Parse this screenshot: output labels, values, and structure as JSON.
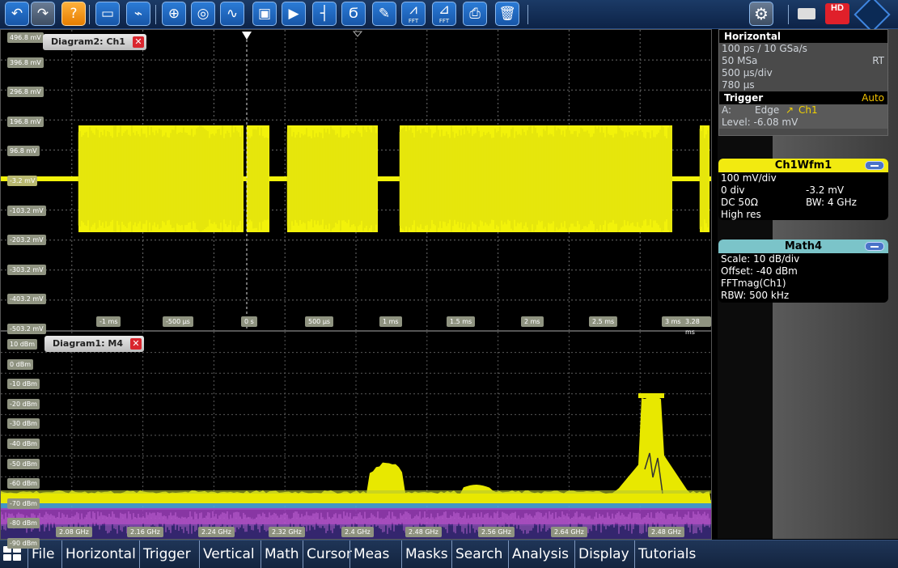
{
  "toolbar": {
    "buttons": [
      {
        "icon": "undo-icon",
        "glyph": "↶",
        "color": "blue"
      },
      {
        "icon": "redo-icon",
        "glyph": "↷",
        "color": "gray"
      },
      {
        "icon": "help-icon",
        "glyph": "?",
        "color": "orange"
      },
      {
        "icon": "open-folder-icon",
        "glyph": "▭",
        "color": "blue"
      },
      {
        "icon": "autoset-icon",
        "glyph": "⌁",
        "color": "blue"
      },
      {
        "icon": "zoom-icon",
        "glyph": "⊕",
        "color": "blue"
      },
      {
        "icon": "binoculars-icon",
        "glyph": "◎",
        "color": "blue"
      },
      {
        "icon": "measurement-icon",
        "glyph": "∿",
        "color": "blue"
      },
      {
        "icon": "mask-icon",
        "glyph": "▣",
        "color": "blue"
      },
      {
        "icon": "cursor-icon",
        "glyph": "▶",
        "color": "blue"
      },
      {
        "icon": "marker-icon",
        "glyph": "┤",
        "color": "blue"
      },
      {
        "icon": "histogram-icon",
        "glyph": "Ϭ",
        "color": "blue"
      },
      {
        "icon": "pencil-icon",
        "glyph": "✎",
        "color": "blue"
      },
      {
        "icon": "fft-icon",
        "glyph": "⩘",
        "label": "FFT",
        "color": "blue"
      },
      {
        "icon": "fft-gate-icon",
        "glyph": "⊿",
        "label": "FFT",
        "color": "blue"
      },
      {
        "icon": "print-icon",
        "glyph": "⎙",
        "color": "blue"
      },
      {
        "icon": "trash-icon",
        "glyph": "🗑",
        "color": "blue"
      }
    ],
    "settings_icon": "gear-icon",
    "mode_label": "HD"
  },
  "diagram2": {
    "title": "Diagram2: Ch1",
    "y_labels": [
      "496.8 mV",
      "396.8 mV",
      "296.8 mV",
      "196.8 mV",
      "96.8 mV",
      "-3.2 mV",
      "-103.2 mV",
      "-203.2 mV",
      "-303.2 mV",
      "-403.2 mV",
      "-503.2 mV"
    ],
    "x_labels": [
      "-1 ms",
      "-500 µs",
      "0 s",
      "500 µs",
      "1 ms",
      "1.5 ms",
      "2 ms",
      "2.5 ms",
      "3 ms",
      "3.28 ms"
    ],
    "colors": {
      "trace": "#f2f20a",
      "grid": "#6c6c6c"
    }
  },
  "diagram1": {
    "title": "Diagram1: M4",
    "y_labels": [
      "10 dBm",
      "0 dBm",
      "-10 dBm",
      "-20 dBm",
      "-30 dBm",
      "-40 dBm",
      "-50 dBm",
      "-60 dBm",
      "-70 dBm",
      "-80 dBm",
      "-90 dBm"
    ],
    "x_labels": [
      "2.08 GHz",
      "2.16 GHz",
      "2.24 GHz",
      "2.32 GHz",
      "2.4 GHz",
      "2.48 GHz",
      "2.56 GHz",
      "2.64 GHz",
      "2.48 GHz"
    ],
    "colors": {
      "trace": "#e8e800",
      "noise_top": "#c8d020",
      "noise_mid": "#4aa6d8",
      "noise_low": "#a040c0"
    }
  },
  "horizontal": {
    "header": "Horizontal",
    "resolution": "100 ps / 10 GSa/s",
    "record_length": "50 MSa",
    "mode": "RT",
    "scale": "500 µs/div",
    "position": "780 µs"
  },
  "trigger": {
    "header": "Trigger",
    "mode": "Auto",
    "source_row_label": "A:",
    "type": "Edge",
    "source": "Ch1",
    "level": "Level: -6.08 mV"
  },
  "ch1wfm": {
    "title": "Ch1Wfm1",
    "scale": "100 mV/div",
    "position": "0 div",
    "offset": "-3.2 mV",
    "coupling": "DC 50Ω",
    "bandwidth": "BW: 4 GHz",
    "acquisition": "High res"
  },
  "math4": {
    "title": "Math4",
    "scale": "Scale:  10 dB/div",
    "offset": "Offset: -40 dBm",
    "function": "FFTmag(Ch1)",
    "rbw": "RBW:   500 kHz"
  },
  "menu": [
    "File",
    "Horizontal",
    "Trigger",
    "Vertical",
    "Math",
    "Cursor",
    "Meas",
    "Masks",
    "Search",
    "Analysis",
    "Display",
    "Tutorials"
  ]
}
